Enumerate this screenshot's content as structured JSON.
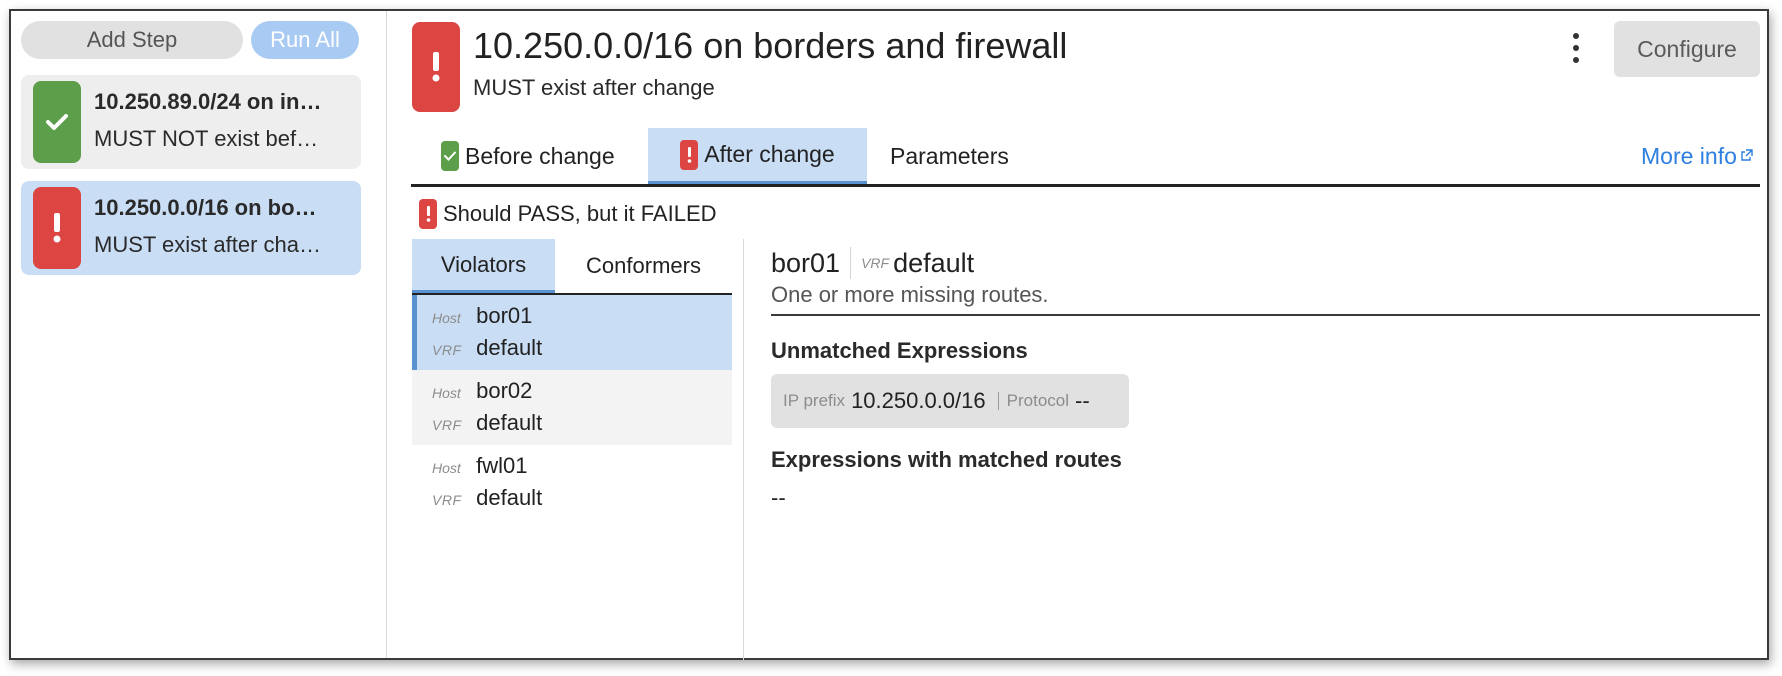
{
  "sidebar": {
    "add_step_label": "Add Step",
    "run_all_label": "Run All",
    "steps": [
      {
        "title": "10.250.89.0/24 on in…",
        "subtitle": "MUST NOT exist bef…",
        "status": "pass"
      },
      {
        "title": "10.250.0.0/16 on bo…",
        "subtitle": "MUST exist after cha…",
        "status": "fail"
      }
    ]
  },
  "header": {
    "title": "10.250.0.0/16 on borders and firewall",
    "subtitle": "MUST exist after change",
    "configure_label": "Configure"
  },
  "tabs": {
    "before_label": "Before change",
    "after_label": "After change",
    "parameters_label": "Parameters",
    "more_info_label": "More info"
  },
  "status_text": "Should PASS, but it FAILED",
  "subtabs": {
    "violators_label": "Violators",
    "conformers_label": "Conformers"
  },
  "host_label": "Host",
  "vrf_label": "VRF",
  "violators": [
    {
      "host": "bor01",
      "vrf": "default"
    },
    {
      "host": "bor02",
      "vrf": "default"
    },
    {
      "host": "fwl01",
      "vrf": "default"
    }
  ],
  "detail": {
    "host": "bor01",
    "vrf": "default",
    "message": "One or more missing routes.",
    "unmatched_heading": "Unmatched Expressions",
    "ip_prefix_label": "IP prefix",
    "ip_prefix_value": "10.250.0.0/16",
    "protocol_label": "Protocol",
    "protocol_value": "--",
    "matched_heading": "Expressions with matched routes",
    "matched_value": "--"
  },
  "colors": {
    "pass": "#5d9e4a",
    "fail": "#dc4541",
    "selected_bg": "#c9ddf5",
    "link": "#2e7fe0"
  }
}
